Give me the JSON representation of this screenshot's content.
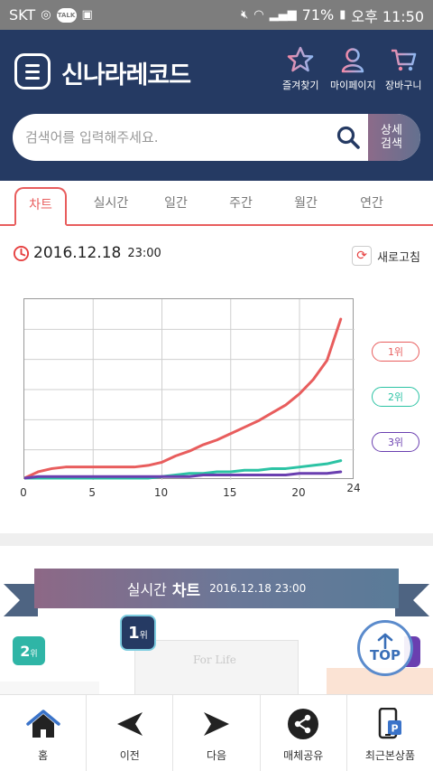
{
  "statusbar": {
    "carrier": "SKT",
    "talk_badge": "TALK",
    "battery": "71%",
    "time": "오후 11:50"
  },
  "header": {
    "logo": "신나라레코드",
    "menu": [
      {
        "label": "즐겨찾기",
        "icon": "star-icon"
      },
      {
        "label": "마이페이지",
        "icon": "person-icon"
      },
      {
        "label": "장바구니",
        "icon": "cart-icon"
      }
    ],
    "search": {
      "placeholder": "검색어를 입력해주세요.",
      "detail_line1": "상세",
      "detail_line2": "검색"
    }
  },
  "tabs": [
    "차트",
    "실시간",
    "일간",
    "주간",
    "월간",
    "연간"
  ],
  "chart_section": {
    "date": "2016.12.18",
    "time": "23:00",
    "refresh_label": "새로고침"
  },
  "chart_data": {
    "type": "line",
    "x": [
      0,
      1,
      2,
      3,
      4,
      5,
      6,
      7,
      8,
      9,
      10,
      11,
      12,
      13,
      14,
      15,
      16,
      17,
      18,
      19,
      20,
      21,
      22,
      23
    ],
    "xticks": [
      "0",
      "5",
      "10",
      "15",
      "20",
      "24"
    ],
    "xlim": [
      0,
      24
    ],
    "ylim": [
      0,
      100
    ],
    "grid": true,
    "legend_position": "right",
    "series": [
      {
        "name": "1위",
        "color": "#e85d5d",
        "values": [
          0,
          4,
          6,
          7,
          7,
          7,
          7,
          7,
          7,
          8,
          10,
          14,
          17,
          21,
          24,
          28,
          32,
          36,
          41,
          46,
          53,
          62,
          74,
          100
        ]
      },
      {
        "name": "2위",
        "color": "#2cc3a4",
        "values": [
          0,
          0,
          0,
          0,
          0,
          0,
          0,
          0,
          0,
          0,
          1,
          2,
          3,
          3,
          4,
          4,
          5,
          5,
          6,
          6,
          7,
          8,
          9,
          11
        ]
      },
      {
        "name": "3위",
        "color": "#6a3fb0",
        "values": [
          0,
          1,
          1,
          1,
          1,
          1,
          1,
          1,
          1,
          1,
          1,
          1,
          1,
          2,
          2,
          2,
          2,
          2,
          2,
          2,
          3,
          3,
          3,
          4
        ]
      }
    ]
  },
  "realtime": {
    "title_light": "실시간",
    "title_bold": "차트",
    "datetime": "2016.12.18 23:00",
    "rank1": {
      "num": "1",
      "unit": "위"
    },
    "rank2": {
      "num": "2",
      "unit": "위"
    },
    "album_text": "For Life"
  },
  "top_button": "TOP",
  "bottomnav": [
    {
      "label": "홈",
      "icon": "home-icon"
    },
    {
      "label": "이전",
      "icon": "back-arrow-icon"
    },
    {
      "label": "다음",
      "icon": "forward-arrow-icon"
    },
    {
      "label": "매체공유",
      "icon": "share-icon"
    },
    {
      "label": "최근본상품",
      "icon": "recent-items-icon"
    }
  ],
  "colors": {
    "header_bg": "#253a63",
    "accent_red": "#e85d5d",
    "teal": "#2cc3a4",
    "purple": "#6a3fb0"
  }
}
